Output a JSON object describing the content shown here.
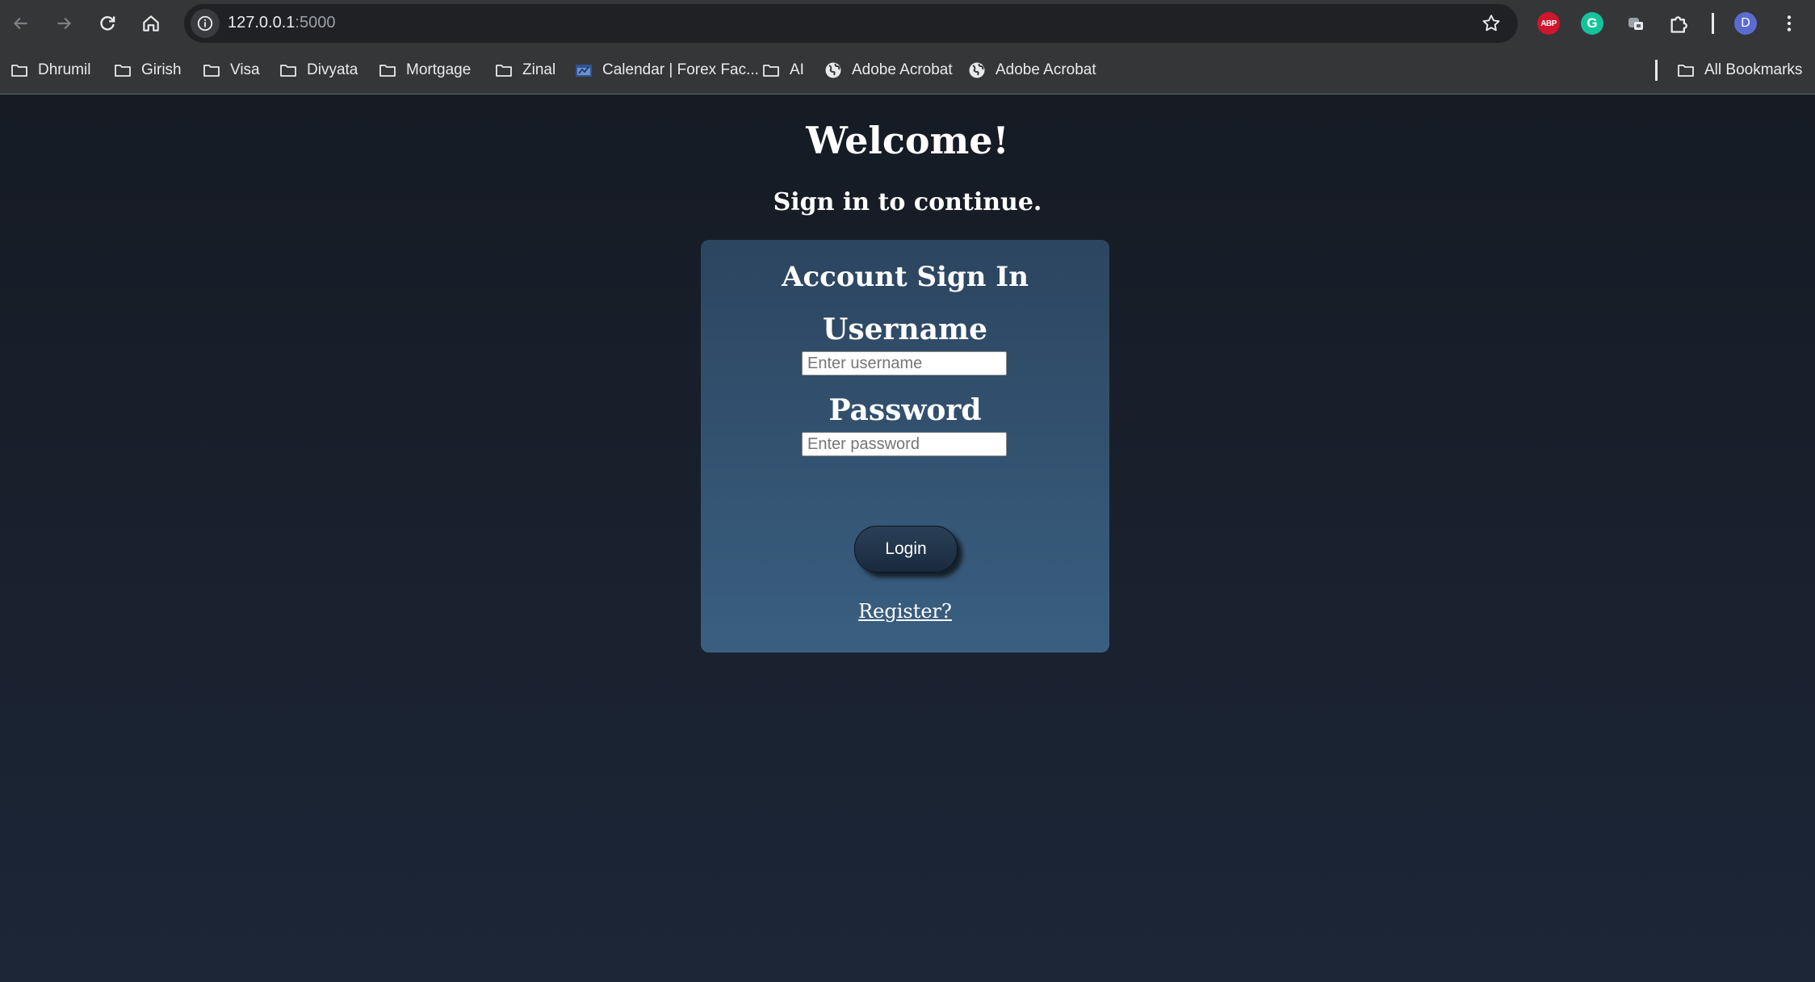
{
  "browser": {
    "url_host": "127.0.0.1",
    "url_port": ":5000",
    "profile_initial": "D",
    "abp_label": "ABP",
    "grammarly_label": "G"
  },
  "bookmarks": {
    "items": [
      {
        "label": "Dhrumil",
        "icon": "folder-icon"
      },
      {
        "label": "Girish",
        "icon": "folder-icon"
      },
      {
        "label": "Visa",
        "icon": "folder-icon"
      },
      {
        "label": "Divyata",
        "icon": "folder-icon"
      },
      {
        "label": "Mortgage",
        "icon": "folder-icon"
      },
      {
        "label": "Zinal",
        "icon": "folder-icon"
      },
      {
        "label": "Calendar | Forex Fac...",
        "icon": "calendar-favicon-icon"
      },
      {
        "label": "AI",
        "icon": "folder-icon"
      },
      {
        "label": "Adobe Acrobat",
        "icon": "globe-icon"
      },
      {
        "label": "Adobe Acrobat",
        "icon": "globe-icon"
      }
    ],
    "all_bookmarks": "All Bookmarks"
  },
  "page": {
    "welcome": "Welcome!",
    "subtitle": "Sign in to continue.",
    "card": {
      "title": "Account Sign In",
      "username_label": "Username",
      "username_placeholder": "Enter username",
      "password_label": "Password",
      "password_placeholder": "Enter password",
      "login_label": "Login",
      "register_label": "Register?"
    }
  },
  "colors": {
    "page_background": "#1b2330",
    "card_top": "#2c4560",
    "card_bottom": "#3a5f80",
    "button": "#1f3247",
    "toolbar": "#353638"
  }
}
